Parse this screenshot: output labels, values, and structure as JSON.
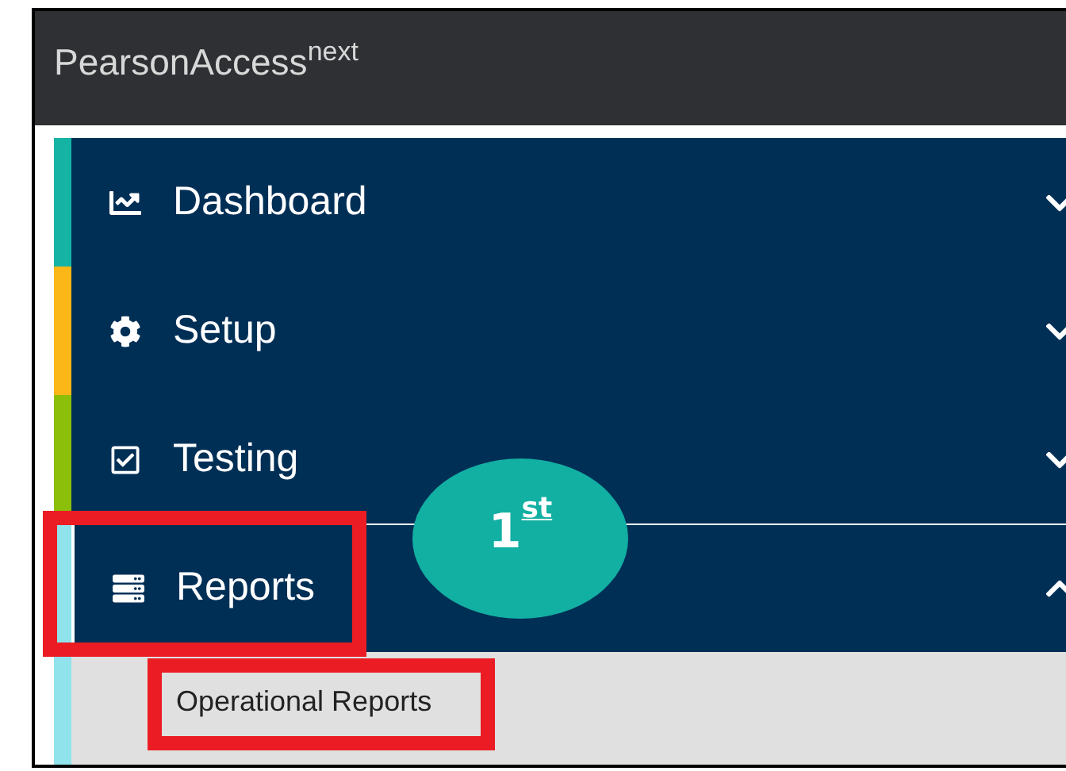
{
  "header": {
    "brand": "PearsonAccess",
    "brand_superscript": "next"
  },
  "menu": [
    {
      "kind": "dashboard",
      "label": "Dashboard",
      "color": "#14b3a3",
      "expanded": false
    },
    {
      "kind": "setup",
      "label": "Setup",
      "color": "#fbb717",
      "expanded": false
    },
    {
      "kind": "testing",
      "label": "Testing",
      "color": "#8cbf0a",
      "expanded": false
    },
    {
      "kind": "reports",
      "label": "Reports",
      "color": "#90e3ea",
      "expanded": true,
      "children": [
        {
          "label": "Operational Reports"
        }
      ]
    }
  ],
  "annotation": {
    "step": "1$^{st}$"
  }
}
